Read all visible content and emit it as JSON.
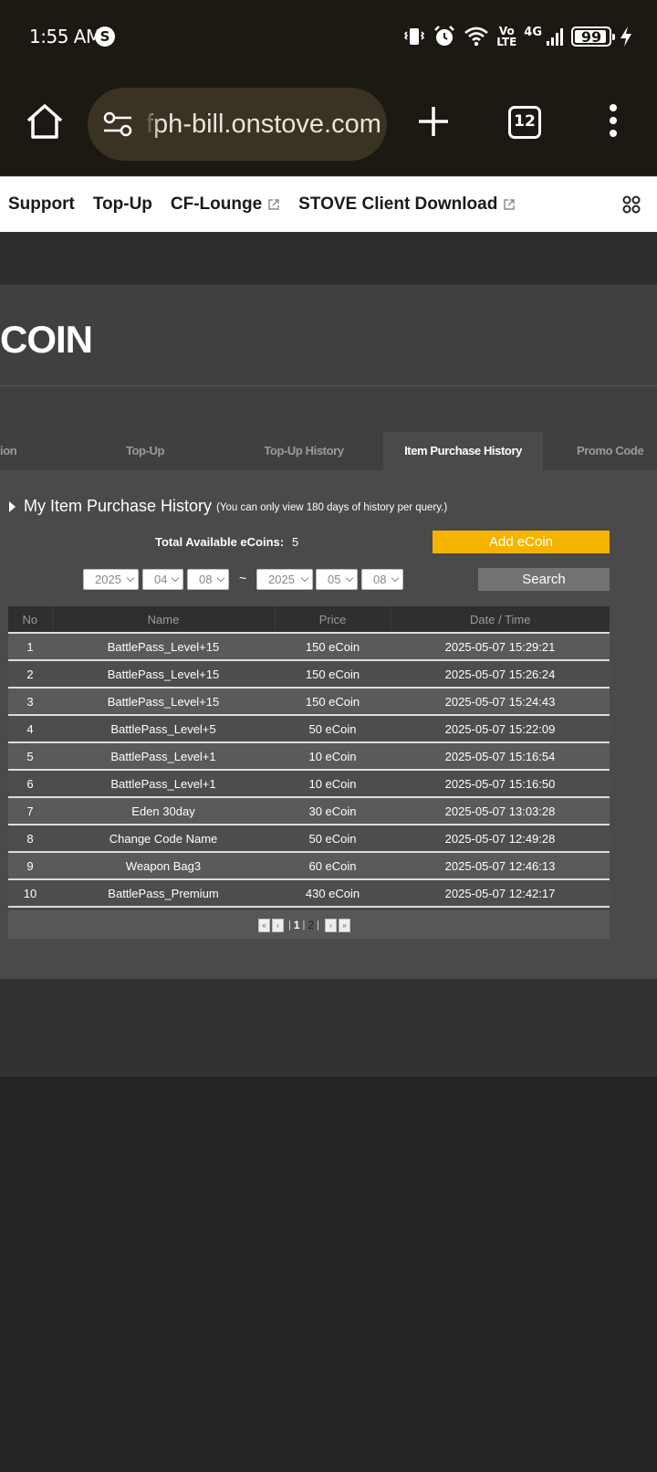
{
  "status_bar": {
    "time": "1:55 AM",
    "volte": "Vo\nLTE",
    "network": "4G",
    "battery": "99"
  },
  "browser": {
    "url": "fph-bill.onstove.com",
    "tab_count": "12"
  },
  "site_nav": {
    "items": [
      {
        "label": "Support",
        "external": false
      },
      {
        "label": "Top-Up",
        "external": false
      },
      {
        "label": "CF-Lounge",
        "external": true
      },
      {
        "label": "STOVE Client Download",
        "external": true
      }
    ]
  },
  "page": {
    "title": "COIN",
    "tabs": [
      {
        "label": "ion",
        "active": false
      },
      {
        "label": "Top-Up",
        "active": false
      },
      {
        "label": "Top-Up History",
        "active": false
      },
      {
        "label": "Item Purchase History",
        "active": true
      },
      {
        "label": "Promo Code",
        "active": false
      }
    ],
    "history_title": "My Item Purchase History",
    "history_note": "(You can only view 180 days of history per query.)",
    "coins_label": "Total Available eCoins:",
    "coins_value": "5",
    "add_button": "Add eCoin",
    "date_from": {
      "year": "2025",
      "month": "04",
      "day": "08"
    },
    "date_separator": "~",
    "date_to": {
      "year": "2025",
      "month": "05",
      "day": "08"
    },
    "search_button": "Search"
  },
  "table": {
    "headers": [
      "No",
      "Name",
      "Price",
      "Date / Time"
    ],
    "rows": [
      [
        "1",
        "BattlePass_Level+15",
        "150 eCoin",
        "2025-05-07 15:29:21"
      ],
      [
        "2",
        "BattlePass_Level+15",
        "150 eCoin",
        "2025-05-07 15:26:24"
      ],
      [
        "3",
        "BattlePass_Level+15",
        "150 eCoin",
        "2025-05-07 15:24:43"
      ],
      [
        "4",
        "BattlePass_Level+5",
        "50 eCoin",
        "2025-05-07 15:22:09"
      ],
      [
        "5",
        "BattlePass_Level+1",
        "10 eCoin",
        "2025-05-07 15:16:54"
      ],
      [
        "6",
        "BattlePass_Level+1",
        "10 eCoin",
        "2025-05-07 15:16:50"
      ],
      [
        "7",
        "Eden 30day",
        "30 eCoin",
        "2025-05-07 13:03:28"
      ],
      [
        "8",
        "Change Code Name",
        "50 eCoin",
        "2025-05-07 12:49:28"
      ],
      [
        "9",
        "Weapon Bag3",
        "60 eCoin",
        "2025-05-07 12:46:13"
      ],
      [
        "10",
        "BattlePass_Premium",
        "430 eCoin",
        "2025-05-07 12:42:17"
      ]
    ]
  },
  "pagination": {
    "current_page": "1",
    "other_page": "2",
    "separator": "|"
  }
}
